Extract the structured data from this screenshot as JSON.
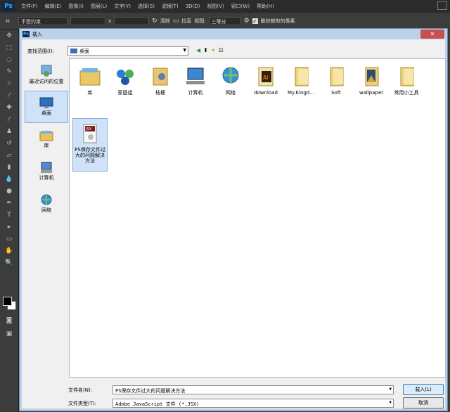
{
  "app": {
    "logo": "Ps",
    "menu": [
      "文件(F)",
      "编辑(E)",
      "图像(I)",
      "图层(L)",
      "文字(Y)",
      "选择(S)",
      "滤镜(T)",
      "3D(D)",
      "视图(V)",
      "窗口(W)",
      "帮助(H)"
    ]
  },
  "options": {
    "ratio_value": "不受约束",
    "swap_symbol": "x",
    "clear_label": "清除",
    "straighten_label": "拉直",
    "view_label": "视图:",
    "view_value": "三等分",
    "delete_pixels_label": "删除裁剪的像素"
  },
  "dialog": {
    "title": "载入",
    "lookin_label": "查找范围(I):",
    "lookin_value": "桌面",
    "sidebar": [
      {
        "label": "最近访问的位置",
        "icon": "recent-places-icon"
      },
      {
        "label": "桌面",
        "icon": "desktop-icon"
      },
      {
        "label": "库",
        "icon": "libraries-icon"
      },
      {
        "label": "计算机",
        "icon": "computer-icon"
      },
      {
        "label": "网络",
        "icon": "network-icon"
      }
    ],
    "files": [
      {
        "label": "库",
        "icon": "libraries-icon"
      },
      {
        "label": "家庭组",
        "icon": "homegroup-icon"
      },
      {
        "label": "桔梗",
        "icon": "user-folder-icon"
      },
      {
        "label": "计算机",
        "icon": "computer-icon"
      },
      {
        "label": "网络",
        "icon": "network-icon"
      },
      {
        "label": "download",
        "icon": "illustrator-file-icon"
      },
      {
        "label": "My.Kingd...",
        "icon": "folder-icon"
      },
      {
        "label": "Soft",
        "icon": "folder-icon"
      },
      {
        "label": "wallpaper",
        "icon": "image-folder-icon"
      },
      {
        "label": "常用小工具",
        "icon": "folder-icon"
      },
      {
        "label": "PS保存文件过大的问题解决方法",
        "icon": "jsx-file-icon"
      }
    ],
    "filename_label": "文件名(N):",
    "filename_value": "PS保存文件过大的问题解决方法",
    "filetype_label": "文件类型(T):",
    "filetype_value": "Adobe JavaScript 文件 (*.JSX)",
    "load_button": "载入(L)",
    "cancel_button": "取消"
  }
}
